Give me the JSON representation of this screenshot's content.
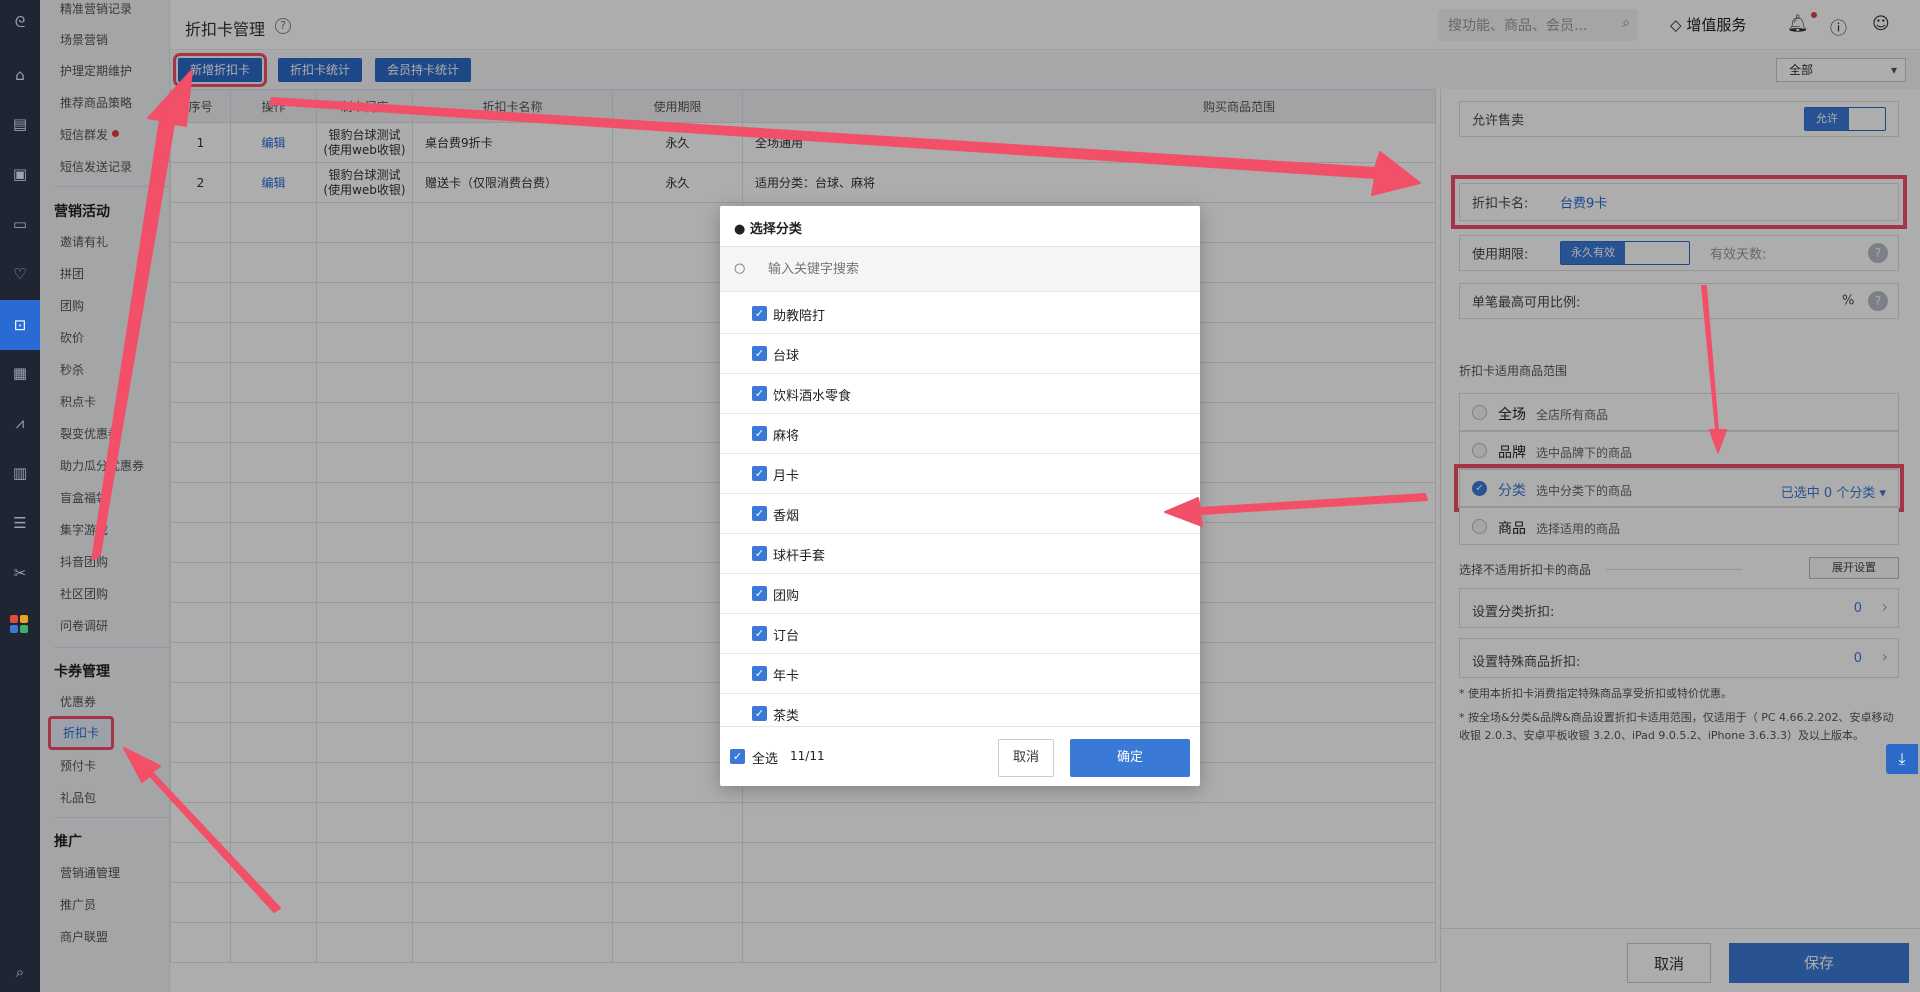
{
  "colors": {
    "accent": "#2d69c9",
    "annotation": "#f24f68",
    "sidebar_dark": "#1f2532"
  },
  "sidebar": {
    "items_top": [
      "精准营销记录",
      "场景营销",
      "护理定期维护",
      "推荐商品策略",
      "短信群发",
      "短信发送记录"
    ],
    "section_marketing": "营销活动",
    "marketing_items": [
      "邀请有礼",
      "拼团",
      "团购",
      "砍价",
      "秒杀",
      "积点卡",
      "裂变优惠券",
      "助力瓜分优惠券",
      "盲盒福袋",
      "集字游戏",
      "抖音团购",
      "社区团购",
      "问卷调研"
    ],
    "section_cards": "卡券管理",
    "card_items": [
      "优惠券",
      "折扣卡",
      "预付卡",
      "礼品包"
    ],
    "section_promo": "推广",
    "promo_items": [
      "营销通管理",
      "推广员",
      "商户联盟"
    ]
  },
  "header": {
    "title": "折扣卡管理",
    "help": "?",
    "search_placeholder": "搜功能、商品、会员...",
    "value_added": "增值服务"
  },
  "toolbar": {
    "btn_new": "新增折扣卡",
    "btn_stats": "折扣卡统计",
    "btn_member_stats": "会员持卡统计",
    "filter_value": "全部"
  },
  "table": {
    "columns": [
      "序号",
      "操作",
      "制卡门店",
      "折扣卡名称",
      "使用期限",
      "购买商品范围"
    ],
    "rows": [
      {
        "no": "1",
        "action": "编辑",
        "store": "银豹台球测试\n(使用web收银)",
        "name": "桌台费9折卡",
        "term": "永久",
        "scope": "全场通用"
      },
      {
        "no": "2",
        "action": "编辑",
        "store": "银豹台球测试\n(使用web收银)",
        "name": "赠送卡（仅限消费台费）",
        "term": "永久",
        "scope": "适用分类：台球、麻将"
      }
    ]
  },
  "panel": {
    "allow_sale_label": "允许售卖",
    "allow_sale_value": "允许",
    "card_name_label": "折扣卡名:",
    "card_name_value": "台费9卡",
    "validity_label": "使用期限:",
    "validity_value": "永久有效",
    "valid_days_label": "有效天数:",
    "max_ratio_label": "单笔最高可用比例:",
    "percent": "%",
    "scope_title": "折扣卡适用商品范围",
    "scope_options": [
      {
        "name": "全场",
        "desc": "全店所有商品"
      },
      {
        "name": "品牌",
        "desc": "选中品牌下的商品"
      },
      {
        "name": "分类",
        "desc": "选中分类下的商品",
        "selected_count": "已选中 0 个分类"
      },
      {
        "name": "商品",
        "desc": "选择适用的商品"
      }
    ],
    "exclude_title": "选择不适用折扣卡的商品",
    "expand_btn": "展开设置",
    "cat_discount_label": "设置分类折扣:",
    "cat_discount_value": "0",
    "special_discount_label": "设置特殊商品折扣:",
    "special_discount_value": "0",
    "note1": "* 使用本折扣卡消费指定特殊商品享受折扣或特价优惠。",
    "note2": "* 按全场&分类&品牌&商品设置折扣卡适用范围，仅适用于（ PC 4.66.2.202、安卓移动收银 2.0.3、安卓平板收银 3.2.0、iPad 9.0.5.2、iPhone 3.6.3.3）及以上版本。",
    "cancel": "取消",
    "save": "保存"
  },
  "modal": {
    "title": "● 选择分类",
    "search_placeholder": "输入关键字搜索",
    "categories": [
      "助教陪打",
      "台球",
      "饮料酒水零食",
      "麻将",
      "月卡",
      "香烟",
      "球杆手套",
      "团购",
      "订台",
      "年卡",
      "茶类"
    ],
    "select_all": "全选",
    "count": "11/11",
    "cancel": "取消",
    "confirm": "确定"
  }
}
